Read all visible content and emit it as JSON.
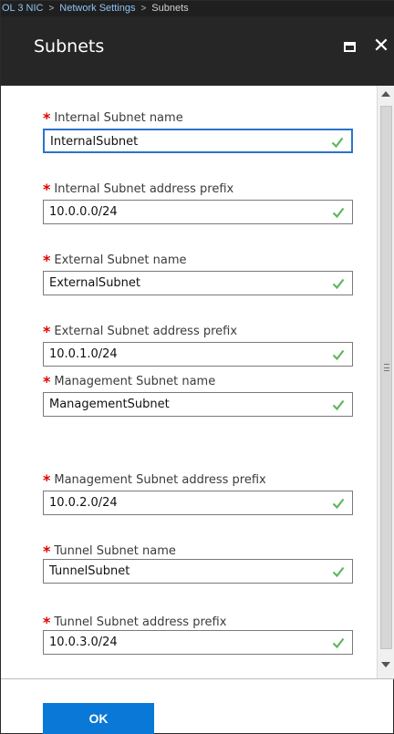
{
  "breadcrumb": {
    "items": [
      "OL 3 NIC",
      "Network Settings",
      "Subnets"
    ]
  },
  "header": {
    "title": "Subnets",
    "maximize_icon": "maximize-icon",
    "close_icon": "close-icon",
    "close_glyph": "✕"
  },
  "form": {
    "required_marker": "*",
    "fields": [
      {
        "label": "Internal Subnet name",
        "value": "InternalSubnet",
        "valid": true
      },
      {
        "label": "Internal Subnet address prefix",
        "value": "10.0.0.0/24",
        "valid": true
      },
      {
        "label": "External Subnet name",
        "value": "ExternalSubnet",
        "valid": true
      },
      {
        "label": "External Subnet address prefix",
        "value": "10.0.1.0/24",
        "valid": true
      },
      {
        "label": "Management Subnet name",
        "value": "ManagementSubnet",
        "valid": true
      },
      {
        "label": "Management Subnet address prefix",
        "value": "10.0.2.0/24",
        "valid": true
      },
      {
        "label": "Tunnel Subnet name",
        "value": "TunnelSubnet",
        "valid": true
      },
      {
        "label": "Tunnel Subnet address prefix",
        "value": "10.0.3.0/24",
        "valid": true
      }
    ]
  },
  "footer": {
    "ok_label": "OK"
  },
  "colors": {
    "header_bg": "#262626",
    "accent": "#0a78d7",
    "focus_border": "#2a74c9",
    "valid_check": "#5cb85c",
    "required": "#e00000"
  }
}
